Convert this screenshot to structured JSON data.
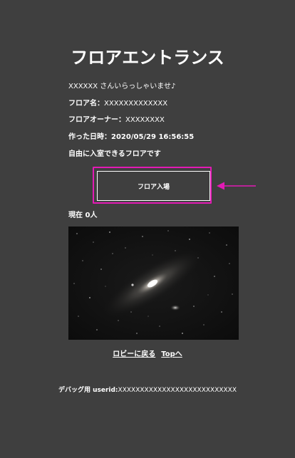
{
  "page": {
    "title": "フロアエントランス"
  },
  "info": {
    "greeting": "XXXXXX さんいらっしゃいませ♪",
    "floor_name_label": "フロア名：",
    "floor_name_value": "XXXXXXXXXXXXX",
    "owner_label": "フロアオーナー：",
    "owner_value": "XXXXXXXX",
    "created_label": "作った日時：",
    "created_value": "2020/05/29 16:56:55",
    "access_note": "自由に入室できるフロアです"
  },
  "enter_button": {
    "label": "フロア入場"
  },
  "annotation": {
    "color": "#e31ab5"
  },
  "presence": {
    "count_text": "現在 0人"
  },
  "image": {
    "icon": "galaxy-image"
  },
  "links": {
    "back_lobby": "ロビーに戻る",
    "top": "Topへ"
  },
  "debug": {
    "label": "デバッグ用 userid:",
    "value": "XXXXXXXXXXXXXXXXXXXXXXXXXXX"
  }
}
